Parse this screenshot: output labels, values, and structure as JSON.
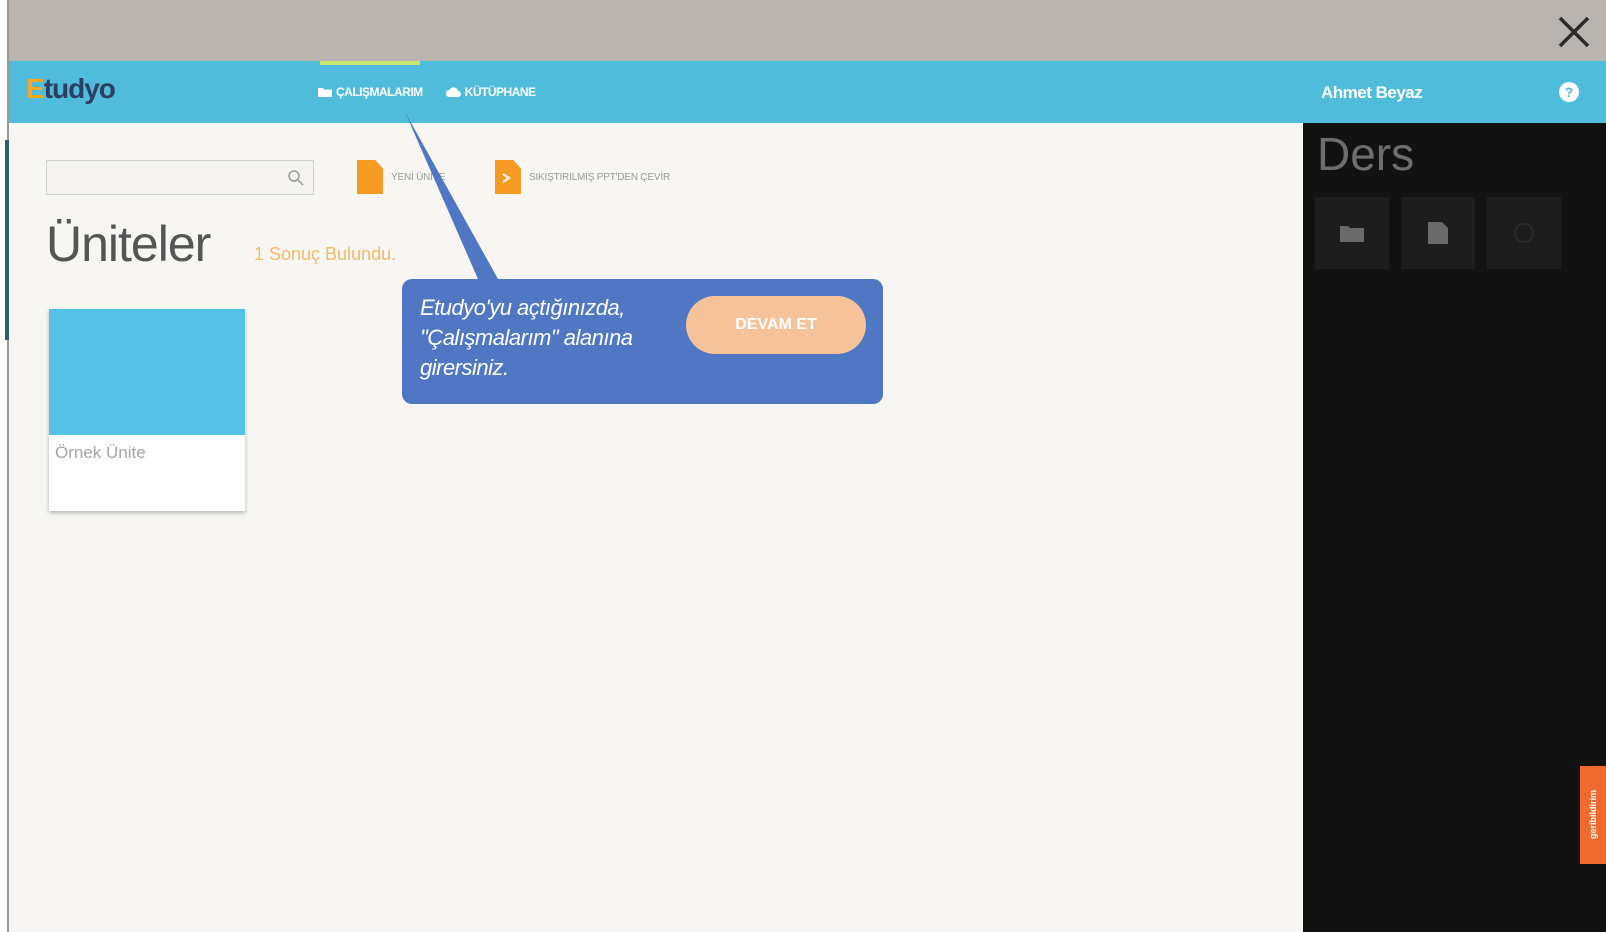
{
  "window": {
    "close_icon": "close-icon"
  },
  "topbar": {
    "logo_first": "E",
    "logo_rest": "tudyo",
    "nav": [
      {
        "label": "ÇALIŞMALARIM",
        "icon": "folder-icon",
        "active": true
      },
      {
        "label": "KÜTÜPHANE",
        "icon": "cloud-icon",
        "active": false
      }
    ]
  },
  "toolbar": {
    "search": {
      "value": "",
      "placeholder": ""
    },
    "new_unit_label": "YENİ ÜNİTE",
    "convert_label": "SIKIŞTIRILMIŞ PPT'DEN ÇEVİR"
  },
  "main": {
    "title": "Üniteler",
    "result_count": "1 Sonuç Bulundu."
  },
  "units": [
    {
      "name": "Örnek Ünite",
      "color": "#54c1e6"
    }
  ],
  "tooltip": {
    "text": "Etudyo'yu açtığınızda, \"Çalışmalarım\" alanına girersiniz.",
    "button_label": "DEVAM ET"
  },
  "right_panel": {
    "user_name": "Ahmet Beyaz",
    "title": "Ders",
    "tools": [
      "folder-icon",
      "document-icon",
      "clock-icon"
    ],
    "feedback_label": "geribildirim"
  },
  "colors": {
    "topbar": "#4fbcdb",
    "accent": "#f59a23",
    "tooltip": "#5077c4",
    "tooltip_button": "#f6c29a",
    "panel": "#121212",
    "active_tab": "#c7e870"
  }
}
